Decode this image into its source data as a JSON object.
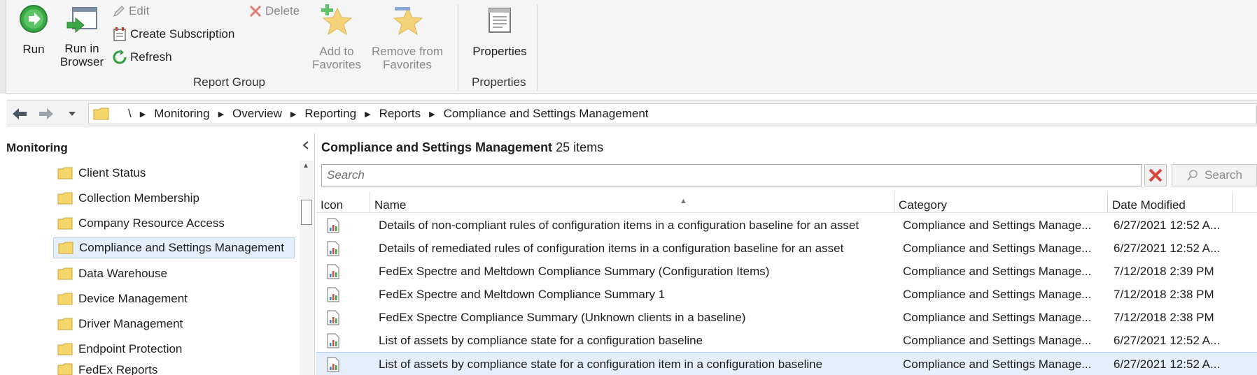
{
  "ribbon": {
    "run_label": "Run",
    "run_in_browser_label": "Run in\nBrowser",
    "edit_label": "Edit",
    "create_subscription_label": "Create Subscription",
    "refresh_label": "Refresh",
    "delete_label": "Delete",
    "report_group_label": "Report Group",
    "add_to_favorites_label": "Add to\nFavorites",
    "remove_from_favorites_label": "Remove from\nFavorites",
    "properties_label": "Properties",
    "properties_group_label": "Properties"
  },
  "address_bar": {
    "crumbs": [
      "\\",
      "Monitoring",
      "Overview",
      "Reporting",
      "Reports",
      "Compliance and Settings Management"
    ]
  },
  "left_pane": {
    "title": "Monitoring",
    "items": [
      {
        "label": "Client Status",
        "selected": false
      },
      {
        "label": "Collection Membership",
        "selected": false
      },
      {
        "label": "Company Resource Access",
        "selected": false
      },
      {
        "label": "Compliance and Settings Management",
        "selected": true
      },
      {
        "label": "Data Warehouse",
        "selected": false
      },
      {
        "label": "Device Management",
        "selected": false
      },
      {
        "label": "Driver Management",
        "selected": false
      },
      {
        "label": "Endpoint Protection",
        "selected": false
      },
      {
        "label": "FedEx Reports",
        "selected": false
      }
    ]
  },
  "right_pane": {
    "title_bold": "Compliance and Settings Management",
    "title_count": "25 items",
    "search_placeholder": "Search",
    "search_button_label": "Search",
    "columns": [
      "Icon",
      "Name",
      "Category",
      "Date Modified"
    ],
    "rows": [
      {
        "name": "Details of non-compliant rules of configuration items in a configuration baseline for an asset",
        "category": "Compliance and Settings Manage...",
        "date": "6/27/2021 12:52 A...",
        "selected": false
      },
      {
        "name": "Details of remediated rules of configuration items in a configuration baseline for an asset",
        "category": "Compliance and Settings Manage...",
        "date": "6/27/2021 12:52 A...",
        "selected": false
      },
      {
        "name": "FedEx Spectre and Meltdown Compliance Summary (Configuration Items)",
        "category": "Compliance and Settings Manage...",
        "date": "7/12/2018 2:39 PM",
        "selected": false
      },
      {
        "name": "FedEx Spectre and Meltdown Compliance Summary 1",
        "category": "Compliance and Settings Manage...",
        "date": "7/12/2018 2:38 PM",
        "selected": false
      },
      {
        "name": "FedEx Spectre Compliance Summary (Unknown clients in a baseline)",
        "category": "Compliance and Settings Manage...",
        "date": "7/12/2018 2:38 PM",
        "selected": false
      },
      {
        "name": "List of assets by compliance state for a configuration baseline",
        "category": "Compliance and Settings Manage...",
        "date": "6/27/2021 12:52 A...",
        "selected": false
      },
      {
        "name": "List of assets by compliance state for a configuration item in a configuration baseline",
        "category": "Compliance and Settings Manage...",
        "date": "6/27/2021 12:52 A...",
        "selected": true
      }
    ]
  },
  "colors": {
    "selection_bg": "#e5eefb",
    "selection_border": "#b9cfee",
    "folder_yellow": "#f5d66b",
    "run_green": "#3aa845",
    "delete_red": "#d9463b"
  }
}
